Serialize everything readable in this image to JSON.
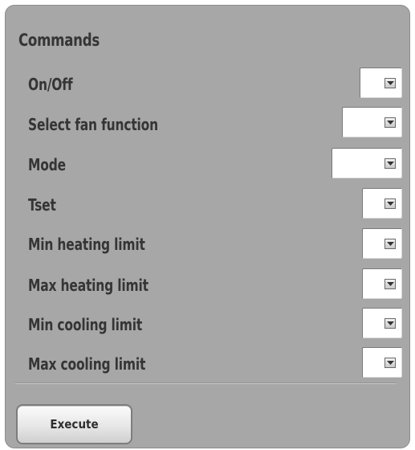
{
  "commands": {
    "title": "Commands",
    "rows": [
      {
        "label": "On/Off",
        "value": ""
      },
      {
        "label": "Select fan function",
        "value": ""
      },
      {
        "label": "Mode",
        "value": ""
      },
      {
        "label": "Tset",
        "value": ""
      },
      {
        "label": "Min heating limit",
        "value": ""
      },
      {
        "label": "Max heating limit",
        "value": ""
      },
      {
        "label": "Min cooling limit",
        "value": ""
      },
      {
        "label": "Max cooling limit",
        "value": ""
      }
    ],
    "execute_label": "Execute"
  },
  "icons": {
    "dropdown": "chevron-down-icon"
  },
  "colors": {
    "panel_background": "#a7a7a7",
    "label_text": "#353535",
    "field_background": "#ffffff"
  }
}
